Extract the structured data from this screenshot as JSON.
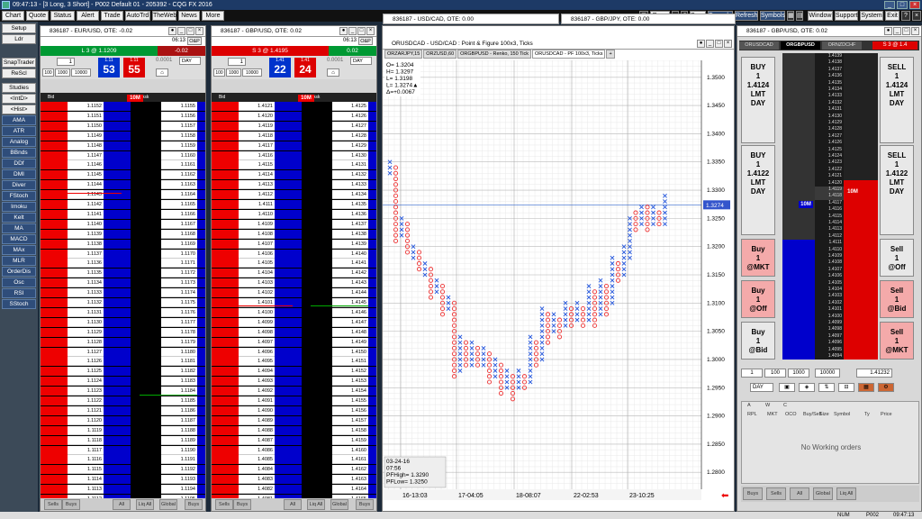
{
  "title": "09:47:13 - [3 Long, 3 Short] - P002 Default 01 - 205392 - CQG FX 2016",
  "menu": [
    "Chart",
    "Quote",
    "Status",
    "Alert",
    "Trade",
    "AutoTrd",
    "TheWeb",
    "News",
    "More"
  ],
  "menu_right": [
    "Page",
    "Save",
    "Formula",
    "Refresh",
    "Symbols",
    "Window",
    "Support",
    "System",
    "Exit"
  ],
  "sidebar": [
    "Setup",
    "Ldr",
    "SnapTrader",
    "ReScl",
    "Studies",
    "<IntD>",
    "<Hist>",
    "AMA",
    "ATR",
    "Analog",
    "BBnds",
    "DDf",
    "DMI",
    "Diver",
    "FStoch",
    "Imoku",
    "Kelt",
    "MA",
    "MACD",
    "MAx",
    "MLR",
    "OrderDis",
    "Osc",
    "RSI",
    "SStoch"
  ],
  "panels": [
    {
      "header": "836187 - EUR/USD, OTE: -0.02",
      "time": "06:13",
      "pos_label": "L 3 @ 1.1209",
      "ote": "-0.02",
      "bid_small": "1.11",
      "bid_big": "53",
      "ask_small": "1.11",
      "ask_big": "55",
      "qty": "1",
      "qty_btns": [
        "100",
        "1000",
        "10000"
      ],
      "ref_price": "0.0001",
      "tif": "DAY",
      "header_bid": "Bid",
      "header_ask": "Ask",
      "size_tag": "10M",
      "buy_prices": [
        "1.1152",
        "1.1151",
        "1.1150",
        "1.1149",
        "1.1148",
        "1.1147",
        "1.1146",
        "1.1145",
        "1.1144",
        "1.1143",
        "1.1142",
        "1.1141",
        "1.1140",
        "1.1139",
        "1.1138",
        "1.1137",
        "1.1136",
        "1.1135",
        "1.1134",
        "1.1133",
        "1.1132",
        "1.1131",
        "1.1130",
        "1.1129",
        "1.1128",
        "1.1127",
        "1.1126",
        "1.1125",
        "1.1124",
        "1.1123",
        "1.1122",
        "1.1121",
        "1.1120",
        "1.1119",
        "1.1118",
        "1.1117",
        "1.1116",
        "1.1115",
        "1.1114",
        "1.1113",
        "1.1112"
      ],
      "sell_prices": [
        "1.1155",
        "1.1156",
        "1.1157",
        "1.1158",
        "1.1159",
        "1.1160",
        "1.1161",
        "1.1162",
        "1.1163",
        "1.1164",
        "1.1165",
        "1.1166",
        "1.1167",
        "1.1168",
        "1.1169",
        "1.1170",
        "1.1171",
        "1.1172",
        "1.1173",
        "1.1174",
        "1.1175",
        "1.1176",
        "1.1177",
        "1.1178",
        "1.1179",
        "1.1180",
        "1.1181",
        "1.1182",
        "1.1183",
        "1.1184",
        "1.1185",
        "1.1186",
        "1.1187",
        "1.1188",
        "1.1189",
        "1.1190",
        "1.1191",
        "1.1192",
        "1.1193",
        "1.1194",
        "1.1195"
      ],
      "footer": [
        "Sells",
        "Buys",
        "All",
        "Liq All",
        "Global",
        "Buys"
      ]
    },
    {
      "header": "836187 - GBP/USD, OTE: 0.02",
      "time": "06:13",
      "pos_label": "S 3 @ 1.4195",
      "ote": "0.02",
      "bid_small": "1.41",
      "bid_big": "22",
      "ask_small": "1.41",
      "ask_big": "24",
      "qty": "1",
      "qty_btns": [
        "100",
        "1000",
        "10000"
      ],
      "ref_price": "0.0001",
      "tif": "DAY",
      "header_bid": "Bid",
      "header_ask": "Ask",
      "size_tag": "10M",
      "buy_prices": [
        "1.4121",
        "1.4120",
        "1.4119",
        "1.4118",
        "1.4117",
        "1.4116",
        "1.4115",
        "1.4114",
        "1.4113",
        "1.4112",
        "1.4111",
        "1.4110",
        "1.4109",
        "1.4108",
        "1.4107",
        "1.4106",
        "1.4105",
        "1.4104",
        "1.4103",
        "1.4102",
        "1.4101",
        "1.4100",
        "1.4099",
        "1.4098",
        "1.4097",
        "1.4096",
        "1.4095",
        "1.4094",
        "1.4093",
        "1.4092",
        "1.4091",
        "1.4090",
        "1.4089",
        "1.4088",
        "1.4087",
        "1.4086",
        "1.4085",
        "1.4084",
        "1.4083",
        "1.4082",
        "1.4081"
      ],
      "sell_prices": [
        "1.4125",
        "1.4126",
        "1.4127",
        "1.4128",
        "1.4129",
        "1.4130",
        "1.4131",
        "1.4132",
        "1.4133",
        "1.4134",
        "1.4135",
        "1.4136",
        "1.4137",
        "1.4138",
        "1.4139",
        "1.4140",
        "1.4141",
        "1.4142",
        "1.4143",
        "1.4144",
        "1.4145",
        "1.4146",
        "1.4147",
        "1.4148",
        "1.4149",
        "1.4150",
        "1.4151",
        "1.4152",
        "1.4153",
        "1.4154",
        "1.4155",
        "1.4156",
        "1.4157",
        "1.4158",
        "1.4159",
        "1.4160",
        "1.4161",
        "1.4162",
        "1.4163",
        "1.4164",
        "1.4165"
      ],
      "footer": [
        "Sells",
        "Buys",
        "All",
        "Liq All",
        "Global",
        "Buys"
      ]
    }
  ],
  "chart": {
    "tab_headers": [
      "836187 - USD/CAD, OTE: 0.00",
      "836187 - GBP/JPY, OTE: 0.00"
    ],
    "title": "ORUSDCAD - USD/CAD : Point & Figure 100x3, Ticks",
    "tabs": [
      "ORZARJPY,15",
      "ORZUSD,60",
      "ORGBPUSD - Renko, 150 Tick",
      "ORUSDCAD - PF 100x3, Ticks",
      "+"
    ],
    "ohlc": [
      "O= 1.3204",
      "H= 1.3297",
      "L= 1.3198",
      "L= 1.3274▲",
      "Δ=+0.0067"
    ],
    "price_labels": [
      "1.3500",
      "1.3450",
      "1.3400",
      "1.3350",
      "1.3300",
      "1.3250",
      "1.3200",
      "1.3150",
      "1.3100",
      "1.3050",
      "1.3000",
      "1.2950",
      "1.2900",
      "1.2850",
      "1.2800"
    ],
    "last_price": "1.3274",
    "time_labels": [
      "16-13:03",
      "17-04:05",
      "18-08:07",
      "22-02:53",
      "23-10:25"
    ],
    "info": [
      "03-24-16",
      "07:56",
      "PFHigh=   1.3290",
      "PFLow=    1.3250"
    ]
  },
  "right": {
    "header": "836187 - GBP/USD, OTE: 0.02",
    "tabs": [
      "ORUSDCAD",
      "ORGBPUSD",
      "ORNZDCHF"
    ],
    "pos": "S 3 @ 1.4",
    "size_tag": "10M",
    "size_tag2": "10M",
    "ladder_prices": [
      "1.4139",
      "1.4138",
      "1.4137",
      "1.4136",
      "1.4135",
      "1.4134",
      "1.4133",
      "1.4132",
      "1.4131",
      "1.4130",
      "1.4129",
      "1.4128",
      "1.4127",
      "1.4126",
      "1.4125",
      "1.4124",
      "1.4123",
      "1.4122",
      "1.4121",
      "1.4120",
      "1.4119",
      "1.4118",
      "1.4117",
      "1.4116",
      "1.4115",
      "1.4114",
      "1.4113",
      "1.4112",
      "1.4111",
      "1.4110",
      "1.4109",
      "1.4108",
      "1.4107",
      "1.4106",
      "1.4105",
      "1.4104",
      "1.4103",
      "1.4102",
      "1.4101",
      "1.4100",
      "1.4099",
      "1.4098",
      "1.4097",
      "1.4096",
      "1.4095",
      "1.4094"
    ],
    "buy_lmt": [
      "BUY",
      "1",
      "1.4124",
      "LMT",
      "DAY"
    ],
    "buy_lmt2": [
      "BUY",
      "1",
      "1.4122",
      "LMT",
      "DAY"
    ],
    "sell_lmt": [
      "SELL",
      "1",
      "1.4124",
      "LMT",
      "DAY"
    ],
    "sell_lmt2": [
      "SELL",
      "1",
      "1.4122",
      "LMT",
      "DAY"
    ],
    "buy_mkt": [
      "Buy",
      "1",
      "@MKT"
    ],
    "buy_off": [
      "Buy",
      "1",
      "@Off"
    ],
    "buy_bid": [
      "Buy",
      "1",
      "@Bid"
    ],
    "sell_off": [
      "Sell",
      "1",
      "@Off"
    ],
    "sell_bid": [
      "Sell",
      "1",
      "@Bid"
    ],
    "sell_mkt": [
      "Sell",
      "1",
      "@MKT"
    ],
    "qty_btns": [
      "1",
      "100",
      "1000",
      "10000"
    ],
    "price_box": "1.41232",
    "tif": "DAY",
    "order_cols": [
      "A",
      "W",
      "C",
      "RPL",
      "MKT",
      "OCO",
      "Buy/Sell",
      "Size",
      "Symbol",
      "Ty",
      "Price"
    ],
    "no_orders": "No Working orders",
    "footer": [
      "Buys",
      "Sells",
      "All",
      "Global",
      "Liq All"
    ]
  },
  "status": {
    "num": "NUM",
    "p": "P002",
    "time": "09:47:13"
  }
}
